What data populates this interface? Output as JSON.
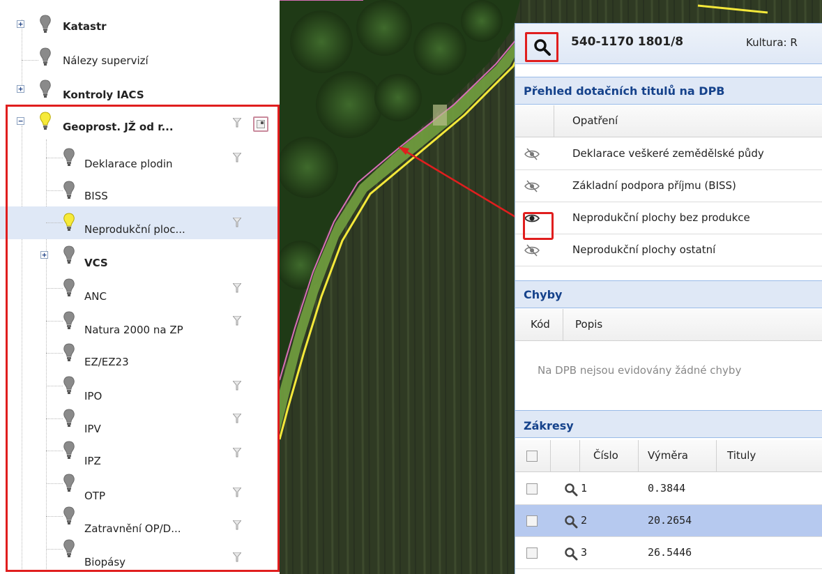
{
  "layer_tree": {
    "items": [
      {
        "label": "Katastr",
        "bold": true,
        "expander": "+",
        "bulb": "off",
        "level": 0,
        "filter": false
      },
      {
        "label": "Nálezy supervizí",
        "bold": false,
        "bulb": "off",
        "level": 0,
        "filter": false
      },
      {
        "label": "Kontroly IACS",
        "bold": true,
        "expander": "+",
        "bulb": "off",
        "level": 0,
        "filter": false
      },
      {
        "label": "Geoprost. JŽ od r...",
        "bold": true,
        "expander": "−",
        "bulb": "on",
        "level": 0,
        "filter": true,
        "legend_button": true
      },
      {
        "label": "Deklarace plodin",
        "bold": false,
        "bulb": "off",
        "level": 1,
        "filter": true
      },
      {
        "label": "BISS",
        "bold": false,
        "bulb": "off",
        "level": 1,
        "filter": false
      },
      {
        "label": "Neprodukční ploc...",
        "bold": false,
        "bulb": "on",
        "level": 1,
        "filter": true,
        "selected": true
      },
      {
        "label": "VCS",
        "bold": true,
        "expander": "+",
        "bulb": "off",
        "level": 1,
        "filter": false
      },
      {
        "label": "ANC",
        "bold": false,
        "bulb": "off",
        "level": 1,
        "filter": true
      },
      {
        "label": "Natura 2000 na ZP",
        "bold": false,
        "bulb": "off",
        "level": 1,
        "filter": true
      },
      {
        "label": "EZ/EZ23",
        "bold": false,
        "bulb": "off",
        "level": 1,
        "filter": false
      },
      {
        "label": "IPO",
        "bold": false,
        "bulb": "off",
        "level": 1,
        "filter": true
      },
      {
        "label": "IPV",
        "bold": false,
        "bulb": "off",
        "level": 1,
        "filter": true
      },
      {
        "label": "IPZ",
        "bold": false,
        "bulb": "off",
        "level": 1,
        "filter": true
      },
      {
        "label": "OTP",
        "bold": false,
        "bulb": "off",
        "level": 1,
        "filter": true
      },
      {
        "label": "Zatravnění OP/D...",
        "bold": false,
        "bulb": "off",
        "level": 1,
        "filter": true
      },
      {
        "label": "Biopásy",
        "bold": false,
        "bulb": "off",
        "level": 1,
        "filter": true
      }
    ]
  },
  "panel": {
    "parcel_id": "540-1170 1801/8",
    "kultura": "Kultura: R",
    "subsidies": {
      "title": "Přehled dotačních titulů na DPB",
      "column": "Opatření",
      "rows": [
        {
          "label": "Deklarace veškeré zemědělské půdy",
          "visible": false
        },
        {
          "label": "Základní podpora příjmu (BISS)",
          "visible": false
        },
        {
          "label": "Neprodukční plochy bez produkce",
          "visible": true
        },
        {
          "label": "Neprodukční plochy ostatní",
          "visible": false
        }
      ]
    },
    "errors": {
      "title": "Chyby",
      "columns": [
        "Kód",
        "Popis"
      ],
      "empty_message": "Na DPB nejsou evidovány žádné chyby"
    },
    "drawings": {
      "title": "Zákresy",
      "columns": [
        "Číslo",
        "Výměra",
        "Tituly"
      ],
      "rows": [
        {
          "cislo": "1",
          "vymera": "0.3844",
          "tituly": ""
        },
        {
          "cislo": "2",
          "vymera": "20.2654",
          "tituly": "",
          "selected": true
        },
        {
          "cislo": "3",
          "vymera": "26.5446",
          "tituly": ""
        }
      ]
    }
  },
  "colors": {
    "highlight": "#e01e1e",
    "panel_border": "#99bbe8",
    "section_title": "#15428b",
    "selected_tree_row": "#dfe8f6",
    "selected_grid_row": "#b6c9ef",
    "bulb_on": "#f6ea3a",
    "bulb_off": "#8a8a8a"
  }
}
